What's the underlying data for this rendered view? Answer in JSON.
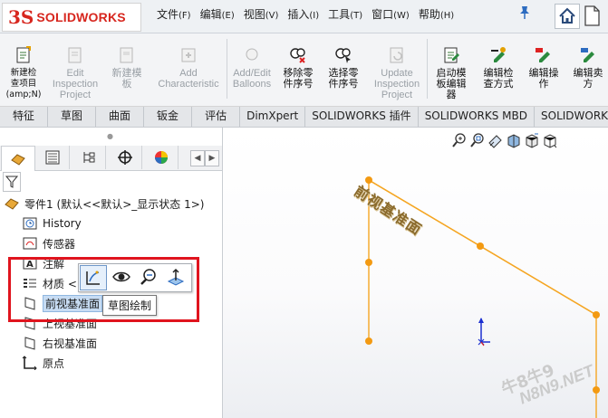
{
  "app": {
    "brand": "SOLIDWORKS",
    "logo_mark": "3S"
  },
  "menu": [
    {
      "label": "文件",
      "acc": "(F)"
    },
    {
      "label": "编辑",
      "acc": "(E)"
    },
    {
      "label": "视图",
      "acc": "(V)"
    },
    {
      "label": "插入",
      "acc": "(I)"
    },
    {
      "label": "工具",
      "acc": "(T)"
    },
    {
      "label": "窗口",
      "acc": "(W)"
    },
    {
      "label": "帮助",
      "acc": "(H)"
    }
  ],
  "commands": [
    {
      "label": "新建检\n查项目\n(amp;N)",
      "icon": "new-inspection-icon",
      "enabled": true
    },
    {
      "label": "Edit\nInspection\nProject",
      "icon": "edit-inspection-icon",
      "enabled": false
    },
    {
      "label": "新建模\n板",
      "icon": "new-template-icon",
      "enabled": false
    },
    {
      "label": "Add\nCharacteristic",
      "icon": "add-characteristic-icon",
      "enabled": false
    },
    {
      "label": "Add/Edit\nBalloons",
      "icon": "balloons-icon",
      "enabled": false
    },
    {
      "label": "移除零\n件序号",
      "icon": "remove-balloon-icon",
      "enabled": true
    },
    {
      "label": "选择零\n件序号",
      "icon": "select-balloon-icon",
      "enabled": true
    },
    {
      "label": "Update\nInspection\nProject",
      "icon": "update-inspection-icon",
      "enabled": false
    },
    {
      "label": "启动模\n板编辑\n器",
      "icon": "template-editor-icon",
      "enabled": true
    },
    {
      "label": "编辑检\n查方式",
      "icon": "edit-method-icon",
      "enabled": true
    },
    {
      "label": "编辑操\n作",
      "icon": "edit-operation-icon",
      "enabled": true
    },
    {
      "label": "编辑卖\n方",
      "icon": "edit-vendor-icon",
      "enabled": true
    }
  ],
  "tabs": [
    "特征",
    "草图",
    "曲面",
    "钣金",
    "评估",
    "DimXpert",
    "SOLIDWORKS 插件",
    "SOLIDWORKS MBD",
    "SOLIDWORKS C"
  ],
  "tree": {
    "part": "零件1 (默认<<默认>_显示状态 1>)",
    "items": [
      {
        "label": "History",
        "icon": "history-icon"
      },
      {
        "label": "传感器",
        "icon": "sensor-icon"
      },
      {
        "label": "注解",
        "icon": "annotation-icon"
      },
      {
        "label": "材质 <",
        "icon": "material-icon"
      },
      {
        "label": "前视基准面",
        "icon": "plane-icon"
      },
      {
        "label": "上视基准面",
        "icon": "plane-icon"
      },
      {
        "label": "右视基准面",
        "icon": "plane-icon"
      },
      {
        "label": "原点",
        "icon": "origin-icon"
      }
    ]
  },
  "context_toolbar": {
    "buttons": [
      "sketch-icon",
      "eye-icon",
      "zoom-to-selection-icon",
      "normal-to-icon"
    ],
    "tooltip": "草图绘制"
  },
  "graphics": {
    "plane_label": "前视基准面",
    "watermark_a": "牛8牛9",
    "watermark_b": "N8N9.NET"
  },
  "colors": {
    "brand_red": "#d7261e",
    "plane_orange": "#f5a623",
    "highlight_red": "#e0141e",
    "selection_blue": "#c7dcf3"
  }
}
